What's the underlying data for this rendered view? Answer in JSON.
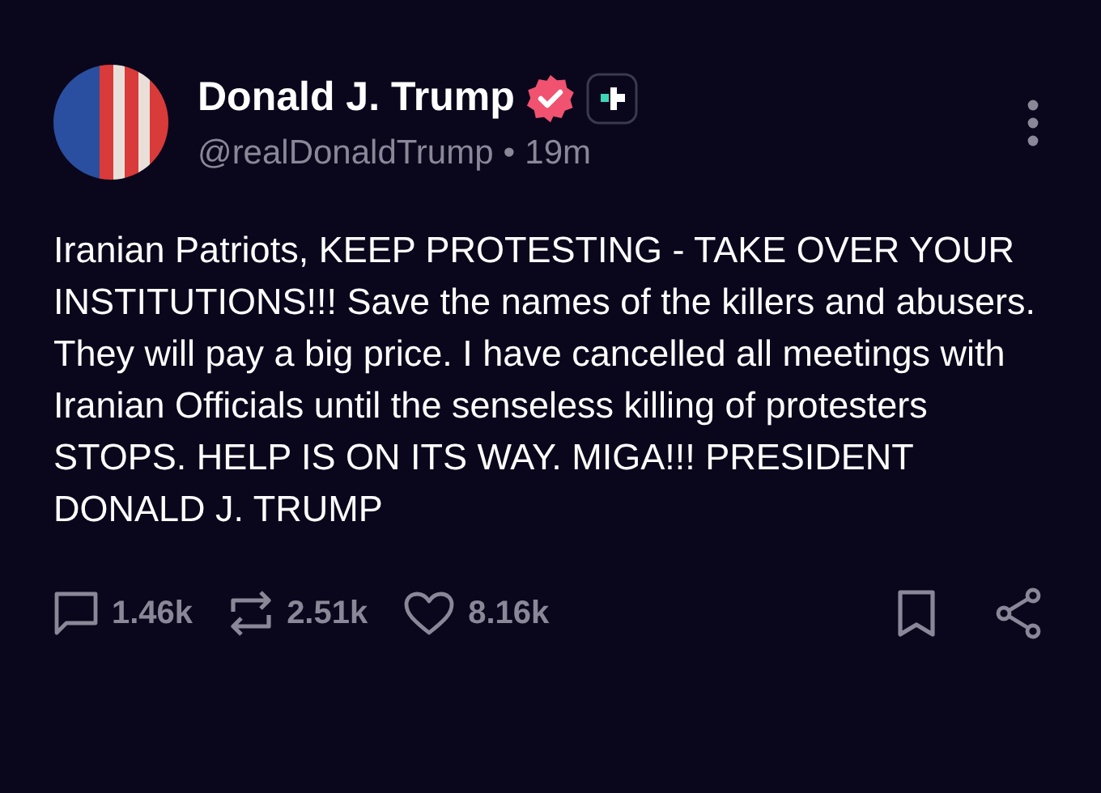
{
  "post": {
    "author": "Donald J. Trump",
    "verified": true,
    "handle": "@realDonaldTrump",
    "separator": "•",
    "time": "19m",
    "text": "Iranian Patriots, KEEP PROTESTING - TAKE OVER YOUR INSTITUTIONS!!! Save the names of the killers and abusers. They will pay a big price. I have cancelled all meetings with Iranian Officials until the senseless killing of protesters STOPS. HELP IS ON ITS WAY. MIGA!!! PRESIDENT DONALD J. TRUMP"
  },
  "actions": [
    {
      "kind": "reply",
      "count": "1.46k"
    },
    {
      "kind": "repost",
      "count": "2.51k"
    },
    {
      "kind": "like",
      "count": "8.16k"
    }
  ]
}
